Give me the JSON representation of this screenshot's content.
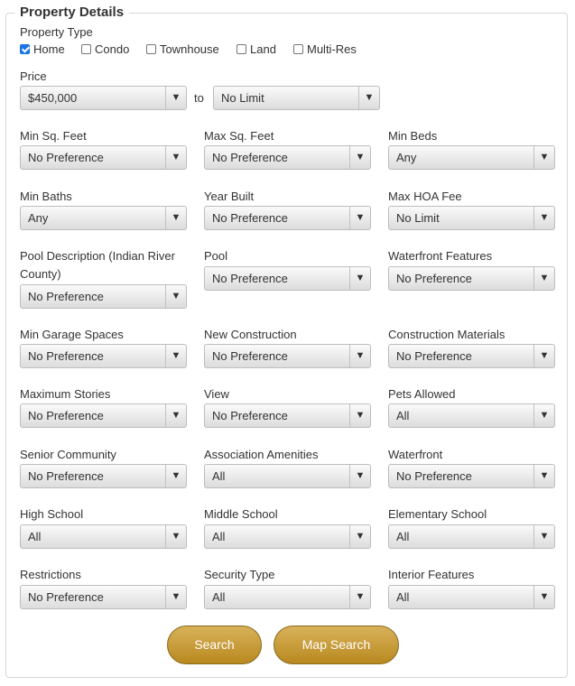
{
  "section_title": "Property Details",
  "property_type": {
    "label": "Property Type",
    "options": [
      {
        "label": "Home",
        "checked": true
      },
      {
        "label": "Condo",
        "checked": false
      },
      {
        "label": "Townhouse",
        "checked": false
      },
      {
        "label": "Land",
        "checked": false
      },
      {
        "label": "Multi-Res",
        "checked": false
      }
    ]
  },
  "price": {
    "label": "Price",
    "min_value": "$450,000",
    "to_label": "to",
    "max_value": "No Limit"
  },
  "filters": [
    {
      "label": "Min Sq. Feet",
      "value": "No Preference"
    },
    {
      "label": "Max Sq. Feet",
      "value": "No Preference"
    },
    {
      "label": "Min Beds",
      "value": "Any"
    },
    {
      "label": "Min Baths",
      "value": "Any"
    },
    {
      "label": "Year Built",
      "value": "No Preference"
    },
    {
      "label": "Max HOA Fee",
      "value": "No Limit"
    },
    {
      "label": "Pool Description (Indian River",
      "label2": "County)",
      "value": "No Preference"
    },
    {
      "label": "Pool",
      "value": "No Preference"
    },
    {
      "label": "Waterfront Features",
      "value": "No Preference"
    },
    {
      "label": "Min Garage Spaces",
      "value": "No Preference"
    },
    {
      "label": "New Construction",
      "value": "No Preference"
    },
    {
      "label": "Construction Materials",
      "value": "No Preference"
    },
    {
      "label": "Maximum Stories",
      "value": "No Preference"
    },
    {
      "label": "View",
      "value": "No Preference"
    },
    {
      "label": "Pets Allowed",
      "value": "All"
    },
    {
      "label": "Senior Community",
      "value": "No Preference"
    },
    {
      "label": "Association Amenities",
      "value": "All"
    },
    {
      "label": "Waterfront",
      "value": "No Preference"
    },
    {
      "label": "High School",
      "value": "All"
    },
    {
      "label": "Middle School",
      "value": "All"
    },
    {
      "label": "Elementary School",
      "value": "All"
    },
    {
      "label": "Restrictions",
      "value": "No Preference"
    },
    {
      "label": "Security Type",
      "value": "All"
    },
    {
      "label": "Interior Features",
      "value": "All"
    }
  ],
  "buttons": {
    "search": "Search",
    "map_search": "Map Search"
  },
  "dropdown_arrow": "▼",
  "colors": {
    "button_gold": "#c89a35",
    "checkbox_blue": "#1a73e8"
  }
}
